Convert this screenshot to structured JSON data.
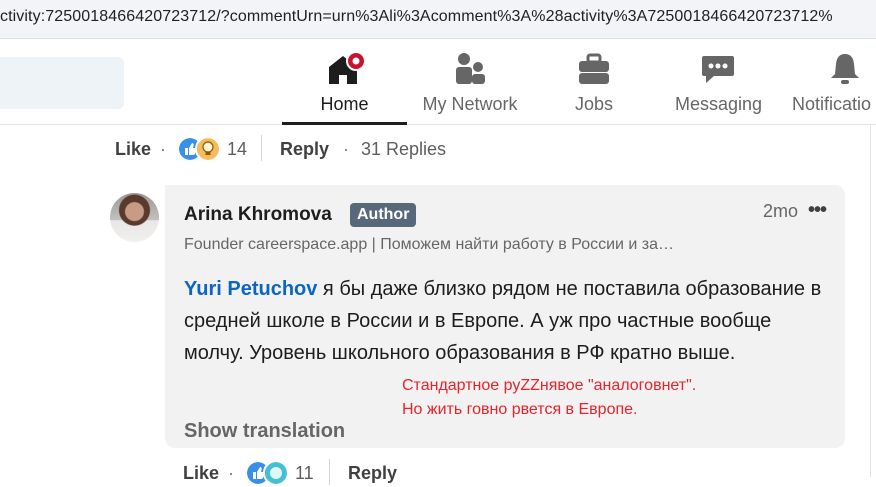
{
  "browser": {
    "url": "ctivity:7250018466420723712/?commentUrn=urn%3Ali%3Acomment%3A%28activity%3A7250018466420723712%"
  },
  "nav": {
    "items": [
      {
        "label": "Home",
        "icon": "home-icon",
        "active": true,
        "badge_color": "#cb112d"
      },
      {
        "label": "My Network",
        "icon": "people-icon"
      },
      {
        "label": "Jobs",
        "icon": "briefcase-icon"
      },
      {
        "label": "Messaging",
        "icon": "chat-icon"
      },
      {
        "label": "Notificatio",
        "icon": "bell-icon"
      }
    ]
  },
  "comment_actions": {
    "like": "Like",
    "reactions_count": "14",
    "reply": "Reply",
    "replies": "31 Replies"
  },
  "reply_comment": {
    "author": "Arina Khromova",
    "badge": "Author",
    "time": "2mo",
    "more": "•••",
    "headline": "Founder careerspace.app | Поможем найти работу в России и за…",
    "mention": "Yuri Petuchov",
    "text": " я бы даже близко рядом не поставила образование в средней школе в России и в Европе. А уж про частные вообще молчу. Уровень школьного образования в РФ кратно выше.",
    "show_translation": "Show translation"
  },
  "annotation": {
    "line1": "Стандартное руZZнявое \"аналоговнет\".",
    "line2": "Но жить говно рвется в Европе.",
    "color": "#e8232a"
  },
  "reply_actions": {
    "like": "Like",
    "reactions_count": "11",
    "reply": "Reply"
  },
  "colors": {
    "link": "#0a66c2",
    "badge": "#56687a",
    "bubble": "#f2f2f2"
  }
}
